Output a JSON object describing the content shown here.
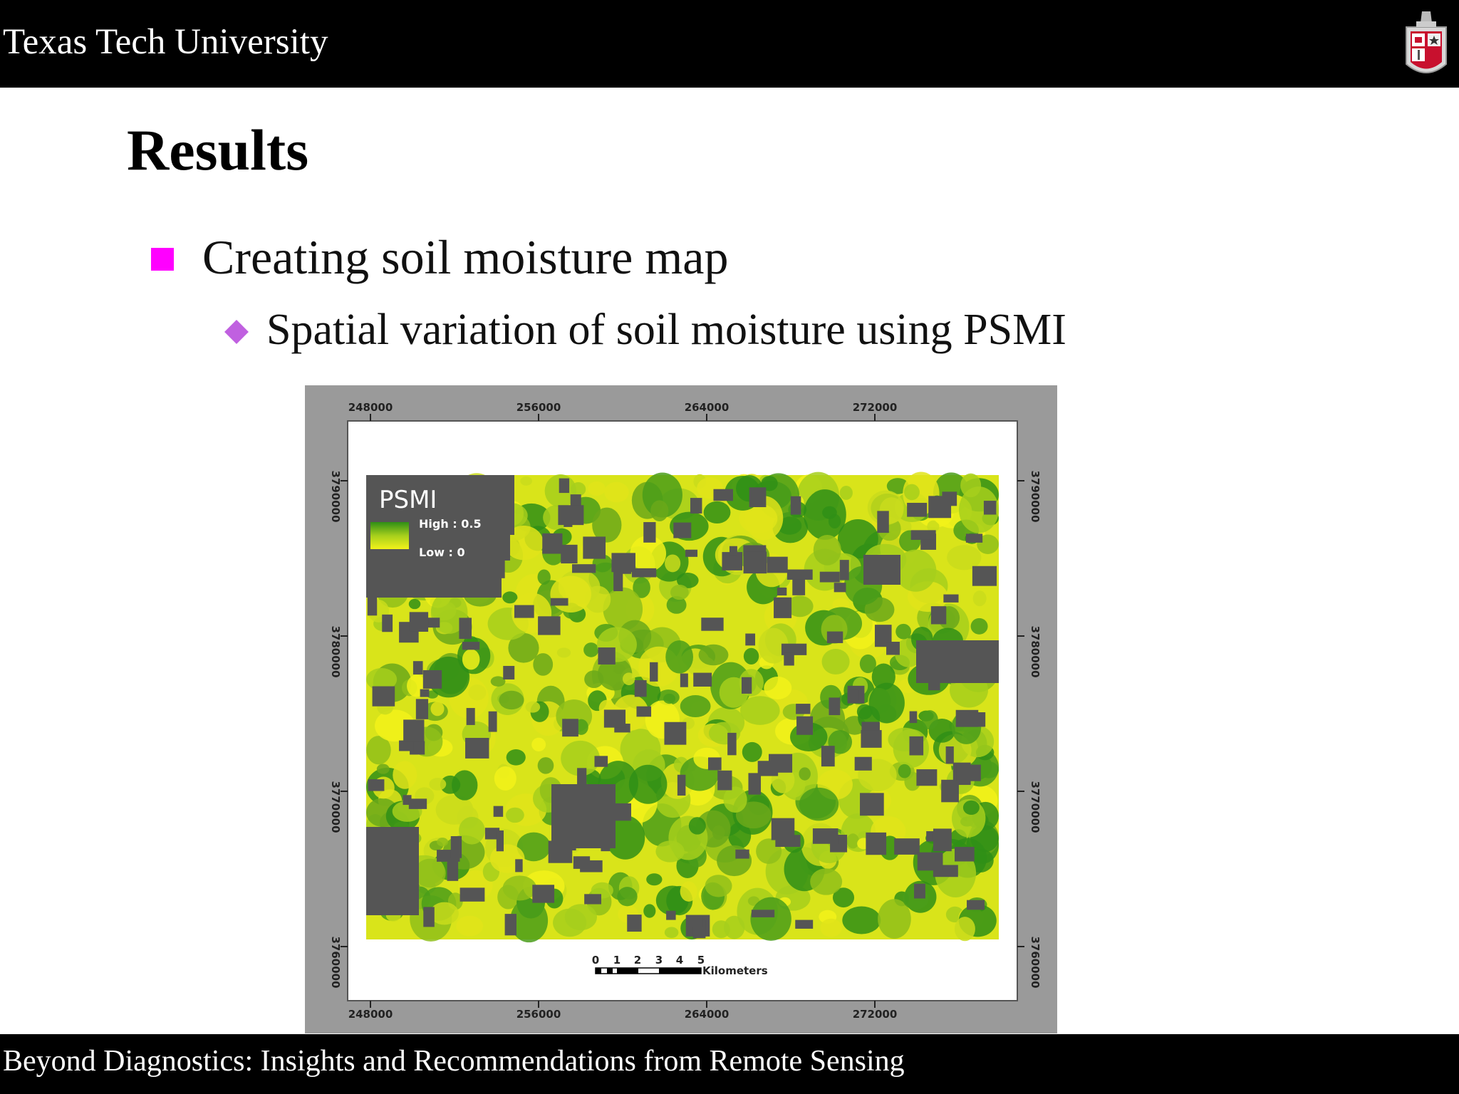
{
  "header": {
    "institution": "Texas Tech University"
  },
  "slide": {
    "title": "Results",
    "bullet1": "Creating soil moisture map",
    "bullet2": "Spatial variation of soil moisture using PSMI"
  },
  "map": {
    "legend_title": "PSMI",
    "legend_high": "High : 0.5",
    "legend_low": "Low : 0",
    "x_ticks": [
      "248000",
      "256000",
      "264000",
      "272000"
    ],
    "y_ticks": [
      "3790000",
      "3780000",
      "3770000",
      "3760000"
    ],
    "scale_numbers": [
      "0",
      "1",
      "2",
      "3",
      "4",
      "5"
    ],
    "scale_unit": "Kilometers",
    "colors": {
      "high": "#2f8f16",
      "mid": "#a6cf1c",
      "low": "#f2f21a",
      "masked": "#555555"
    }
  },
  "footer": {
    "text": "Beyond Diagnostics:  Insights and Recommendations from Remote Sensing"
  },
  "colors": {
    "bullet_square": "#ff00ff",
    "bullet_diamond": "#c060e0"
  }
}
